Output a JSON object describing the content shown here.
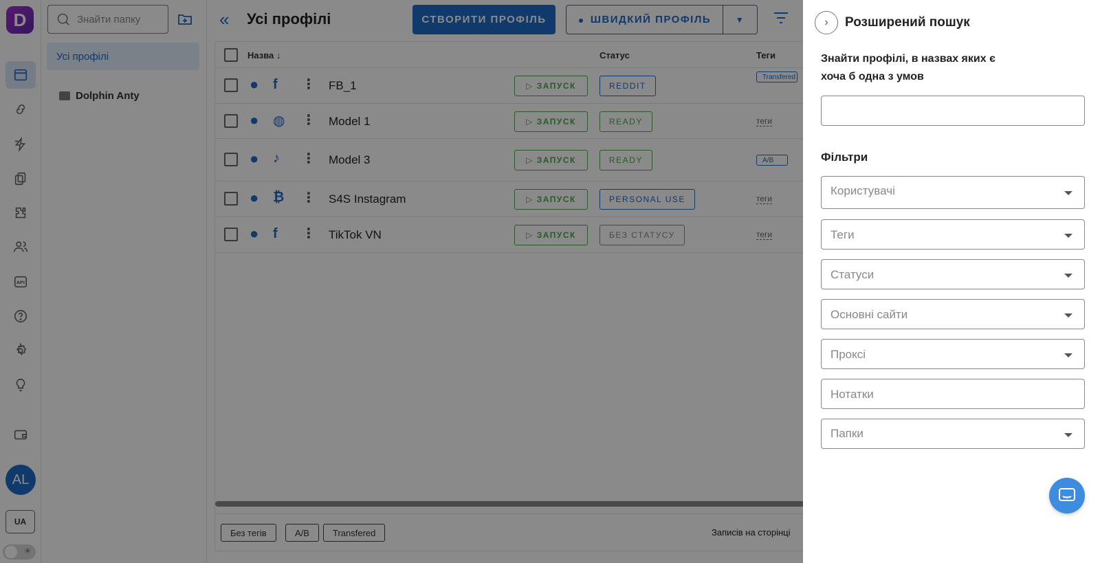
{
  "colors": {
    "accent": "#1e6ac8",
    "launch_green": "#4aa84c",
    "status_blue": "#1e6ac8",
    "status_green": "#4aa84c",
    "status_gray": "#888888",
    "overlay": "rgba(0,0,0,0.46)"
  },
  "app": {
    "logo_letter": "D"
  },
  "rail": {
    "items": [
      {
        "icon": "browser-profiles-icon"
      },
      {
        "icon": "link-icon"
      },
      {
        "icon": "automation-icon"
      },
      {
        "icon": "copy-icon"
      },
      {
        "icon": "extensions-puzzle-icon"
      },
      {
        "icon": "users-icon"
      },
      {
        "icon": "api-icon"
      },
      {
        "icon": "help-icon"
      },
      {
        "icon": "settings-gear-icon"
      },
      {
        "icon": "lightbulb-icon"
      },
      {
        "icon": "wallet-icon"
      }
    ],
    "avatar_initials": "AL",
    "language": "UA"
  },
  "folders": {
    "search_placeholder": "Знайти папку",
    "all_profiles_label": "Усі профілі",
    "items": [
      {
        "label": "Dolphin Anty"
      }
    ]
  },
  "header": {
    "title": "Усі профілі",
    "create_button": "СТВОРИТИ ПРОФІЛЬ",
    "quick_button": "ШВИДКИЙ ПРОФІЛЬ"
  },
  "table": {
    "columns": {
      "name": "Назва",
      "status": "Статус",
      "tags": "Теги"
    },
    "launch_label": "ЗАПУСК",
    "rows": [
      {
        "name": "FB_1",
        "os": "apple",
        "site": "facebook",
        "status": "REDDIT",
        "status_color": "blue",
        "tag": "Transfered",
        "tag_style": "box"
      },
      {
        "name": "Model 1",
        "os": "apple",
        "site": "globe",
        "status": "READY",
        "status_color": "green",
        "tag": "теги",
        "tag_style": "text"
      },
      {
        "name": "Model 3",
        "os": "apple",
        "site": "tiktok",
        "status": "READY",
        "status_color": "green",
        "tag": "A/B",
        "tag_style": "box"
      },
      {
        "name": "S4S Instagram",
        "os": "apple",
        "site": "bitcoin",
        "status": "PERSONAL USE",
        "status_color": "blue",
        "tag": "теги",
        "tag_style": "text"
      },
      {
        "name": "TikTok VN",
        "os": "apple",
        "site": "facebook",
        "status": "БЕЗ СТАТУСУ",
        "status_color": "gray",
        "tag": "теги",
        "tag_style": "text"
      }
    ],
    "footer_tags": [
      "Без тегів",
      "A/B",
      "Transfered"
    ],
    "per_page_label": "Записів на сторінці"
  },
  "drawer": {
    "title": "Розширений пошук",
    "subtitle": "Знайти профілі, в назвах яких є хоча б одна з умов",
    "filters_heading": "Фільтри",
    "fields": [
      {
        "placeholder": "Користувачі",
        "dropdown": true
      },
      {
        "placeholder": "Теги",
        "dropdown": true
      },
      {
        "placeholder": "Статуси",
        "dropdown": true
      },
      {
        "placeholder": "Основні сайти",
        "dropdown": true
      },
      {
        "placeholder": "Проксі",
        "dropdown": true
      },
      {
        "placeholder": "Нотатки",
        "dropdown": false
      },
      {
        "placeholder": "Папки",
        "dropdown": true
      }
    ]
  }
}
